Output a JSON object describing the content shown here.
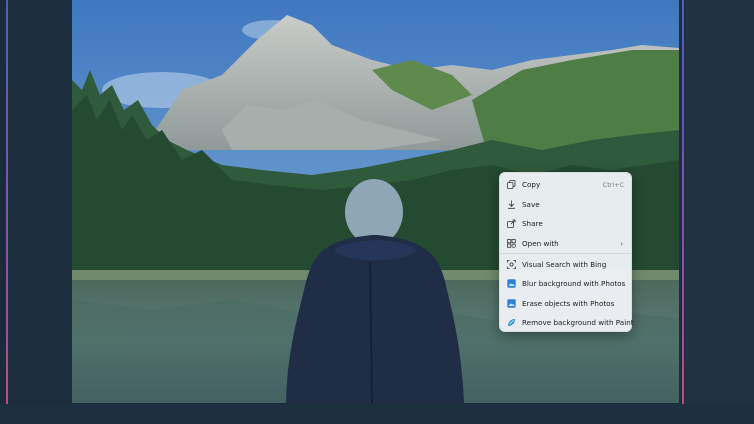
{
  "context_menu": {
    "items": [
      {
        "label": "Copy",
        "shortcut": "Ctrl+C",
        "icon": "copy-icon"
      },
      {
        "label": "Save",
        "icon": "download-icon"
      },
      {
        "label": "Share",
        "icon": "share-icon"
      },
      {
        "label": "Open with",
        "icon": "open-with-icon",
        "submenu": "›"
      },
      {
        "label": "Visual Search with Bing",
        "icon": "visual-search-icon"
      },
      {
        "label": "Blur background with Photos",
        "icon": "photos-blur-icon",
        "accent": "#2f7fd6"
      },
      {
        "label": "Erase objects with Photos",
        "icon": "photos-erase-icon",
        "accent": "#2f7fd6"
      },
      {
        "label": "Remove background with Paint",
        "icon": "paint-icon",
        "accent": "#1e90d8"
      }
    ]
  },
  "colors": {
    "frame_top": "#4a5fc4",
    "frame_bottom": "#c9457e",
    "background": "#1a2c3c"
  }
}
